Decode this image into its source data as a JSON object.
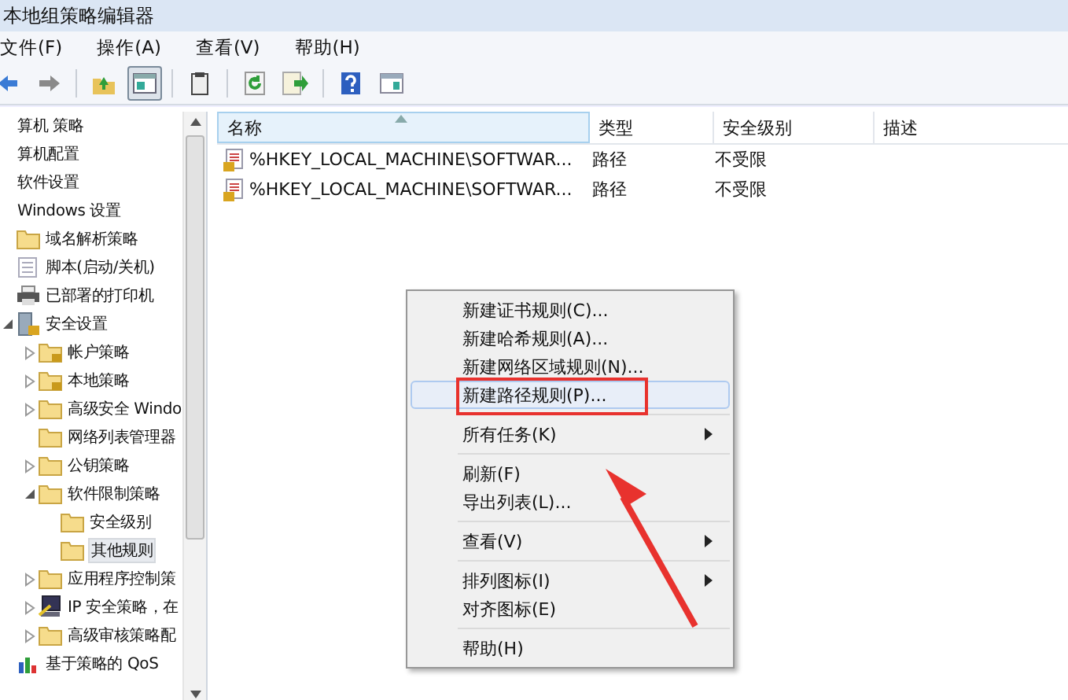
{
  "window": {
    "title": "本地组策略编辑器"
  },
  "menu_bar": [
    "文件(F)",
    "操作(A)",
    "查看(V)",
    "帮助(H)"
  ],
  "toolbar": [
    {
      "kind": "back",
      "pressed": false
    },
    {
      "kind": "forward",
      "pressed": false
    },
    {
      "kind": "up",
      "pressed": false
    },
    {
      "kind": "tree",
      "pressed": true
    },
    {
      "kind": "clipboard",
      "pressed": false
    },
    {
      "kind": "refresh",
      "pressed": false
    },
    {
      "kind": "export",
      "pressed": false
    },
    {
      "kind": "help",
      "pressed": false
    },
    {
      "kind": "panel",
      "pressed": false
    }
  ],
  "tree": [
    {
      "label": "算机 策略",
      "selected": false,
      "children": [
        {
          "label": "算机配置",
          "selected": false,
          "children": [
            {
              "label": "软件设置",
              "selected": false
            },
            {
              "label": "Windows 设置",
              "selected": false,
              "children": [
                {
                  "label": "域名解析策略",
                  "kind": "folder",
                  "selected": false
                },
                {
                  "label": "脚本(启动/关机)",
                  "kind": "script",
                  "selected": false
                },
                {
                  "label": "已部署的打印机",
                  "kind": "printer",
                  "selected": false
                },
                {
                  "label": "安全设置",
                  "kind": "security",
                  "selected": false,
                  "expanded": true,
                  "children": [
                    {
                      "label": "帐户策略",
                      "kind": "locked-folder",
                      "selected": false,
                      "expanded": false
                    },
                    {
                      "label": "本地策略",
                      "kind": "locked-folder",
                      "selected": false,
                      "expanded": false
                    },
                    {
                      "label": "高级安全 Windo",
                      "kind": "folder",
                      "selected": false,
                      "expanded": false
                    },
                    {
                      "label": "网络列表管理器",
                      "kind": "folder",
                      "selected": false
                    },
                    {
                      "label": "公钥策略",
                      "kind": "folder",
                      "selected": false,
                      "expanded": false
                    },
                    {
                      "label": "软件限制策略",
                      "kind": "folder",
                      "selected": false,
                      "expanded": true,
                      "children": [
                        {
                          "label": "安全级别",
                          "kind": "folder",
                          "selected": false
                        },
                        {
                          "label": "其他规则",
                          "kind": "folder",
                          "selected": true
                        }
                      ]
                    },
                    {
                      "label": "应用程序控制策",
                      "kind": "folder",
                      "selected": false,
                      "expanded": false
                    },
                    {
                      "label": "IP 安全策略，在",
                      "kind": "network",
                      "selected": false,
                      "expanded": false
                    },
                    {
                      "label": "高级审核策略配",
                      "kind": "folder",
                      "selected": false,
                      "expanded": false
                    }
                  ]
                },
                {
                  "label": "基于策略的 QoS",
                  "kind": "chart",
                  "selected": false
                }
              ]
            }
          ]
        }
      ]
    }
  ],
  "list": {
    "columns": [
      {
        "label": "名称",
        "sorted": true
      },
      {
        "label": "类型",
        "sorted": false
      },
      {
        "label": "安全级别",
        "sorted": false
      },
      {
        "label": "描述",
        "sorted": false
      }
    ],
    "rows": [
      [
        "%HKEY_LOCAL_MACHINE\\SOFTWAR...",
        "路径",
        "不受限"
      ],
      [
        "%HKEY_LOCAL_MACHINE\\SOFTWAR...",
        "路径",
        "不受限"
      ]
    ]
  },
  "context_menu": [
    {
      "kind": "item",
      "label": "新建证书规则(C)...",
      "selected": false
    },
    {
      "kind": "item",
      "label": "新建哈希规则(A)...",
      "selected": false
    },
    {
      "kind": "item",
      "label": "新建网络区域规则(N)...",
      "selected": false
    },
    {
      "kind": "item",
      "label": "新建路径规则(P)...",
      "selected": true,
      "boxed": true
    },
    {
      "kind": "separator"
    },
    {
      "kind": "item",
      "label": "所有任务(K)",
      "selected": false,
      "submenu": true
    },
    {
      "kind": "separator"
    },
    {
      "kind": "item",
      "label": "刷新(F)",
      "selected": false
    },
    {
      "kind": "item",
      "label": "导出列表(L)...",
      "selected": false
    },
    {
      "kind": "separator"
    },
    {
      "kind": "item",
      "label": "查看(V)",
      "selected": false,
      "submenu": true
    },
    {
      "kind": "separator"
    },
    {
      "kind": "item",
      "label": "排列图标(I)",
      "selected": false,
      "submenu": true
    },
    {
      "kind": "item",
      "label": "对齐图标(E)",
      "selected": false
    },
    {
      "kind": "separator"
    },
    {
      "kind": "item",
      "label": "帮助(H)",
      "selected": false
    }
  ]
}
